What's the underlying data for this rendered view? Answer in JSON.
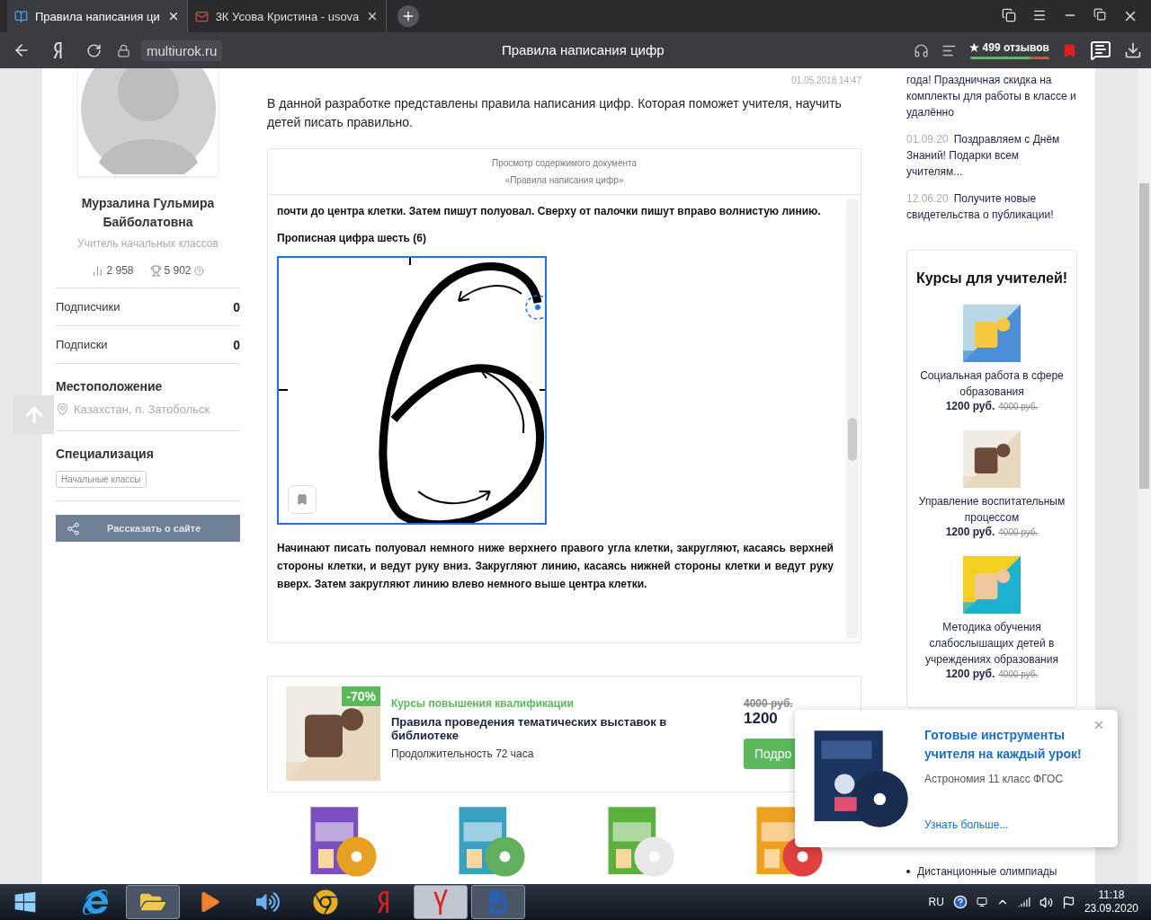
{
  "browser": {
    "tabs": [
      {
        "title": "Правила написания ци",
        "kind": "book",
        "selected": true
      },
      {
        "title": "3К Усова Кристина - usova",
        "kind": "mail",
        "selected": false
      }
    ],
    "address": "multiurok.ru",
    "page_title": "Правила написания цифр",
    "reviews": "★ 499 отзывов"
  },
  "profile": {
    "name": "Мурзалина Гульмира Байболатовна",
    "role": "Учитель начальных классов",
    "views": "2 958",
    "rating": "5 902",
    "counters": [
      {
        "label": "Подписчики",
        "value": "0"
      },
      {
        "label": "Подписки",
        "value": "0"
      }
    ],
    "location_heading": "Местоположение",
    "location": "Казахстан, п. Затобольск",
    "specialization_heading": "Специализация",
    "tags": [
      "Начальные классы"
    ],
    "share_button": "Рассказать о сайте"
  },
  "article": {
    "date": "01.05.2018 14:47",
    "description": "В данной разработке представлены правила написания цифр. Которая поможет учителя, научить детей писать правильно.",
    "viewer": {
      "caption": [
        "Просмотр содержимого документа",
        "«Правила написания цифр»"
      ],
      "blocks": [
        {
          "kind": "text",
          "text": "почти до центра клетки. Затем пишут полуовал. Сверху от палочки пишут вправо волнистую линию."
        },
        {
          "kind": "heading",
          "text": "Прописная цифра шесть (6)"
        },
        {
          "kind": "figure"
        },
        {
          "kind": "text",
          "text": "Начинают писать полуовал немного ниже верхнего правого угла клетки, закругляют, касаясь верхней стороны клетки, и ведут руку вниз. Закругляют линию, касаясь нижней стороны клетки и ведут руку вверх. Затем закругляют линию влево немного выше центра клетки."
        }
      ]
    }
  },
  "course_ad": {
    "discount": "-70%",
    "category": "Курсы повышения квалификации",
    "title": "Правила проведения тематических выставок в библиотеке",
    "duration": "Продолжительность 72 часа",
    "old_price": "4000 руб.",
    "price": "1200",
    "button": "Подро"
  },
  "products": [
    {
      "kind": "picture"
    },
    {
      "kind": "picture"
    },
    {
      "kind": "picture"
    },
    {
      "kind": "picture"
    }
  ],
  "news": [
    {
      "text": "года! Праздничная скидка на комплекты для работы в классе и удалённо"
    },
    {
      "date": "01.09.20",
      "text": "Поздравляем с Днём Знаний! Подарки всем учителям..."
    },
    {
      "date": "12.06.20",
      "text": "Получите новые свидетельства о публикации!"
    }
  ],
  "courses": {
    "title": "Курсы для учителей!",
    "items": [
      {
        "title": "Социальная работа в сфере образования",
        "price": "1200 руб.",
        "old_price": "4000 руб."
      },
      {
        "title": "Управление воспитательным процессом",
        "price": "1200 руб.",
        "old_price": "4000 руб."
      },
      {
        "title": "Методика обучения слабослышащих детей в учреждениях образования",
        "price": "1200 руб.",
        "old_price": "4000 руб."
      }
    ]
  },
  "links": [
    "Дистанционные олимпиады"
  ],
  "popup": {
    "title": "Готовые инструменты учителя на каждый урок!",
    "subtitle": "Астрономия 11 класс ФГОС",
    "link": "Узнать больше..."
  },
  "taskbar": {
    "apps": [
      {
        "kind": "ie",
        "selected": false,
        "running": false
      },
      {
        "kind": "folder",
        "selected": false,
        "running": true
      },
      {
        "kind": "media",
        "selected": false,
        "running": false
      },
      {
        "kind": "sound",
        "selected": false,
        "running": false
      },
      {
        "kind": "chrome",
        "selected": false,
        "running": false
      },
      {
        "kind": "yandex",
        "selected": false,
        "running": false
      },
      {
        "kind": "ybrowser",
        "selected": true,
        "running": true
      },
      {
        "kind": "word",
        "selected": false,
        "running": true
      }
    ],
    "language": "RU",
    "time": "11:18",
    "date": "23.09.2020"
  }
}
